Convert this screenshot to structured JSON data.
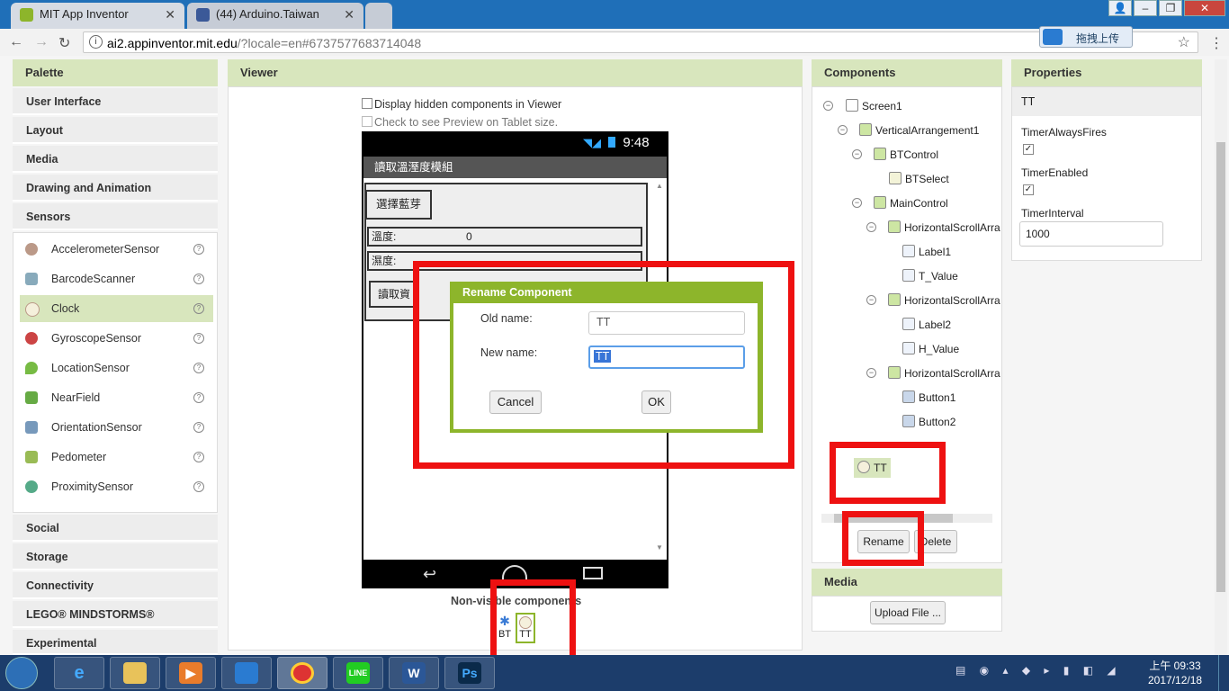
{
  "browser": {
    "tabs": [
      {
        "title": "MIT App Inventor"
      },
      {
        "title": "(44) Arduino.Taiwan"
      }
    ],
    "url_host": "ai2.appinventor.mit.edu",
    "url_rest": "/?locale=en#6737577683714048",
    "extension_label": "拖拽上传"
  },
  "palette": {
    "header": "Palette",
    "categories_top": [
      "User Interface",
      "Layout",
      "Media",
      "Drawing and Animation",
      "Sensors"
    ],
    "sensor_items": [
      {
        "label": "AccelerometerSensor",
        "icon": "accelerometer-icon"
      },
      {
        "label": "BarcodeScanner",
        "icon": "barcode-icon"
      },
      {
        "label": "Clock",
        "icon": "clock-icon",
        "selected": true
      },
      {
        "label": "GyroscopeSensor",
        "icon": "gyroscope-icon"
      },
      {
        "label": "LocationSensor",
        "icon": "location-icon"
      },
      {
        "label": "NearField",
        "icon": "nfc-icon"
      },
      {
        "label": "OrientationSensor",
        "icon": "orientation-icon"
      },
      {
        "label": "Pedometer",
        "icon": "pedometer-icon"
      },
      {
        "label": "ProximitySensor",
        "icon": "proximity-icon"
      }
    ],
    "help_glyph": "?",
    "categories_bottom": [
      "Social",
      "Storage",
      "Connectivity",
      "LEGO® MINDSTORMS®",
      "Experimental"
    ]
  },
  "viewer": {
    "header": "Viewer",
    "display_hidden": "Display hidden components in Viewer",
    "tablet_preview": "Check to see Preview on Tablet size.",
    "phone": {
      "time": "9:48",
      "title": "讀取溫溼度模組",
      "select_bt": "選擇藍芽",
      "temp_label": "溫度:",
      "temp_value": "0",
      "hum_label": "濕度:",
      "read_btn": "讀取資"
    },
    "nonvisible_label": "Non-visible components",
    "nonvisible_items": [
      "BT",
      "TT"
    ]
  },
  "dialog": {
    "title": "Rename Component",
    "old_label": "Old name:",
    "old_value": "TT",
    "new_label": "New name:",
    "new_value": "TT",
    "cancel": "Cancel",
    "ok": "OK"
  },
  "components": {
    "header": "Components",
    "tree": [
      {
        "label": "Screen1"
      },
      {
        "label": "VerticalArrangement1"
      },
      {
        "label": "BTControl"
      },
      {
        "label": "BTSelect"
      },
      {
        "label": "MainControl"
      },
      {
        "label": "HorizontalScrollArra"
      },
      {
        "label": "Label1"
      },
      {
        "label": "T_Value"
      },
      {
        "label": "HorizontalScrollArra"
      },
      {
        "label": "Label2"
      },
      {
        "label": "H_Value"
      },
      {
        "label": "HorizontalScrollArra"
      },
      {
        "label": "Button1"
      },
      {
        "label": "Button2"
      }
    ],
    "selected": "TT",
    "rename": "Rename",
    "delete": "Delete"
  },
  "media": {
    "header": "Media",
    "upload": "Upload File ..."
  },
  "properties": {
    "header": "Properties",
    "component": "TT",
    "timer_always_fires": "TimerAlwaysFires",
    "timer_enabled": "TimerEnabled",
    "timer_interval": "TimerInterval",
    "timer_interval_value": "1000",
    "timer_always_fires_checked": true,
    "timer_enabled_checked": true
  },
  "taskbar": {
    "time_period": "上午 09:33",
    "date": "2017/12/18"
  },
  "colors": {
    "accent_green": "#8db52b",
    "header_green": "#d8e6bd",
    "highlight_red": "#ee1111"
  }
}
